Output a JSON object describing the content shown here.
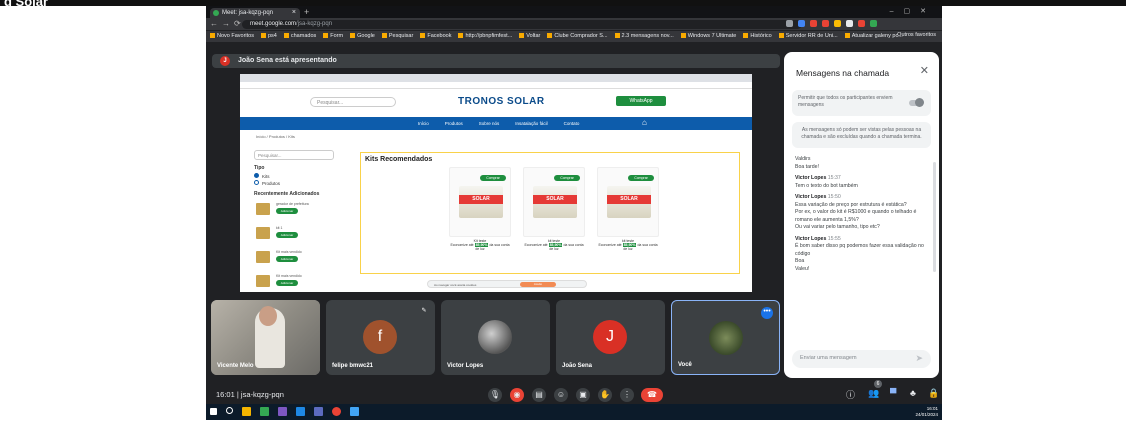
{
  "header_label": "g Solar",
  "browser": {
    "tab_title": "Meet: jsa-kqzg-pqn",
    "url_host": "meet.google.com",
    "url_path": "/jsa-kqzg-pqn",
    "bookmarks": [
      "Novo Favoritos",
      "ps4",
      "chamados",
      "Form",
      "Google",
      "Pesquisar",
      "Facebook",
      "http://pbnpfimfest...",
      "Voltar",
      "Clube Comprador S...",
      "2.3 mensagens nov...",
      "Windows 7 Ultimate",
      "Histórico",
      "Servidor RR de Uni...",
      "Atualizar galeny pc..."
    ],
    "bookmarks_right": "Outros favoritos"
  },
  "presenting": {
    "avatar_letter": "J",
    "text": "João Sena está apresentando"
  },
  "shared_site": {
    "search_placeholder": "Pesquisar...",
    "brand": "TRONOS SOLAR",
    "whatsapp": "WhatsApp",
    "nav": [
      "Início",
      "Produtos",
      "Sobre nós",
      "Insatalação fácil",
      "Contato"
    ],
    "breadcrumb": "Início / Produtos / Kits",
    "filter_search": "Pesquisar...",
    "filter_type_title": "Tipo",
    "filter_options": [
      "Kits",
      "Produtos"
    ],
    "recent_title": "Recentemente Adicionados",
    "recent_items": [
      {
        "name": "gerador de prefeitura",
        "btn": "Adicionar"
      },
      {
        "name": "kit 1",
        "btn": "Adicionar"
      },
      {
        "name": "Kit mais vendido",
        "btn": "Adicionar"
      },
      {
        "name": "Kit mais vendido",
        "btn": "Adicionar"
      }
    ],
    "kits_title": "Kits Recomendados",
    "products": [
      {
        "label": "SOLAR",
        "name": "Kit teste",
        "eco_pre": "Economize até",
        "eco_pct": "85,90%",
        "eco_post": "da sua conta de luz",
        "btn": "Comprar"
      },
      {
        "label": "SOLAR",
        "name": "kit teste",
        "eco_pre": "Economize até",
        "eco_pct": "85,90%",
        "eco_post": "da sua conta de luz",
        "btn": "Comprar"
      },
      {
        "label": "SOLAR",
        "name": "kit teste",
        "eco_pre": "Economize até",
        "eco_pct": "85,90%",
        "eco_post": "da sua conta de luz",
        "btn": "Comprar"
      }
    ],
    "cookie_text": "Ao navegar você aceita cookies",
    "cookie_ok": "Aceito"
  },
  "participants": [
    {
      "name": "Vicente Melo",
      "avatar": "",
      "color": "#8a8a84"
    },
    {
      "name": "felipe bmwc21",
      "avatar": "f",
      "color": "#a0522d"
    },
    {
      "name": "Victor Lopes",
      "avatar": "",
      "color": ""
    },
    {
      "name": "João Sena",
      "avatar": "J",
      "color": "#d93025"
    },
    {
      "name": "Você",
      "avatar": "",
      "color": ""
    }
  ],
  "chat": {
    "title": "Mensagens na chamada",
    "permission_text": "Permitir que todos os participantes enviem mensagens",
    "info_text": "As mensagens só podem ser vistas pelas pessoas na chamada e são excluídas quando a chamada termina.",
    "messages": [
      {
        "who": "",
        "time": "",
        "lines": [
          "Valdirs",
          "Boa tarde!"
        ]
      },
      {
        "who": "Victor Lopes",
        "time": "15:37",
        "lines": [
          "Tem o texto do bot também"
        ]
      },
      {
        "who": "Victor Lopes",
        "time": "15:50",
        "lines": [
          "Essa variação de preço por estrutura é estática?",
          "Por ex, o valor do kit é R$1000 e quando o telhado é romano ele aumenta 1,5%?",
          "Ou vai variar pelo tamanho, tipo etc?"
        ]
      },
      {
        "who": "Victor Lopes",
        "time": "15:55",
        "lines": [
          "É bom saber disso pq podemos fazer essa validação no código",
          "Boa",
          "Valeu!"
        ]
      }
    ],
    "input_placeholder": "Enviar uma mensagem"
  },
  "bottom": {
    "time": "16:01",
    "separator": "|",
    "meeting_code": "jsa-kqzg-pqn",
    "participant_count": "6"
  },
  "taskbar": {
    "time": "16:01",
    "date": "24/01/2024"
  }
}
